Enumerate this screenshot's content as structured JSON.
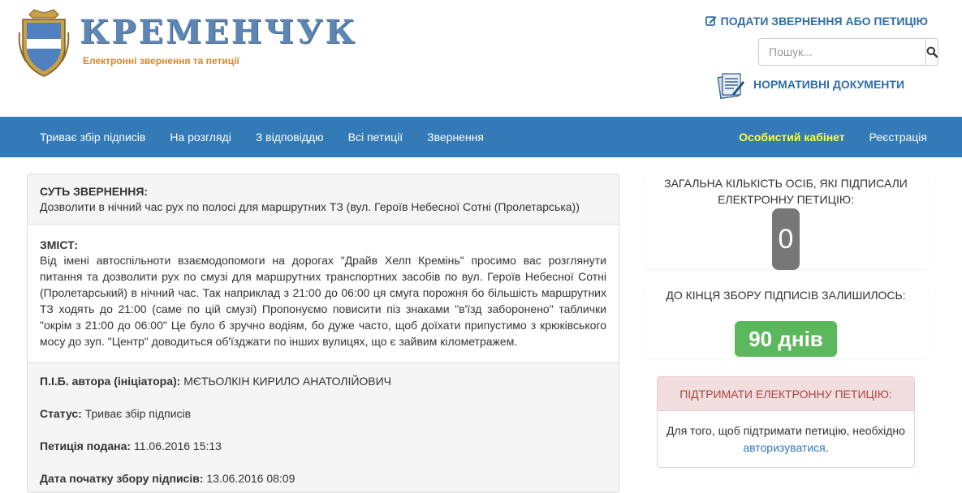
{
  "header": {
    "logo_title": "КРЕМЕНЧУК",
    "logo_subtitle": "Електронні звернення та петиції",
    "submit_link": "ПОДАТИ ЗВЕРНЕННЯ АБО ПЕТИЦІЮ",
    "search_placeholder": "Пошук...",
    "docs_link": "НОРМАТИВНІ ДОКУМЕНТИ"
  },
  "nav": {
    "left": [
      "Триває збір підписів",
      "На розгляді",
      "З відповіддю",
      "Всі петиції",
      "Звернення"
    ],
    "cabinet": "Особистий кабінет",
    "register": "Реєстрація"
  },
  "petition": {
    "essence_label": "СУТЬ ЗВЕРНЕННЯ:",
    "essence_text": "Дозволити в нічний час рух по полосі для маршрутних ТЗ (вул. Героїв Небесної Сотні (Пролетарська))",
    "content_label": "ЗМІСТ:",
    "content_text": "Від імені автоспільноти взаємодопомоги на дорогах \"Драйв Хелп Кремінь\" просимо вас розглянути питання та дозволити рух по смузі для маршрутних транспортних засобів по вул. Героїв Небесної Сотні (Пролетарський) в нічний час. Так наприклад з 21:00 до 06:00 ця смуга порожня бо більшість маршрутних ТЗ ходять до 21:00 (саме по цій смузі) Пропонуємо повисити піз знаками \"в'їзд заборонено\" таблички \"окрім з 21:00 до 06:00\" Це було б зручно водіям, бо дуже часто, щоб доїхати припустимо з крюківського мосу до зуп. \"Центр\" доводиться об'їзджати по інших вулицях, що є зайвим кілометражем.",
    "author_label": "П.І.Б. автора (ініціатора):",
    "author_value": "МЄТЬОЛКІН КИРИЛО АНАТОЛІЙОВИЧ",
    "status_label": "Статус:",
    "status_value": "Триває збір підписів",
    "submitted_label": "Петиція подана:",
    "submitted_value": "11.06.2016 15:13",
    "start_label": "Дата початку збору підписів:",
    "start_value": "13.06.2016 08:09"
  },
  "sidebar": {
    "count_title": "ЗАГАЛЬНА КІЛЬКІСТЬ ОСІБ, ЯКІ ПІДПИСАЛИ ЕЛЕКТРОННУ ПЕТИЦІЮ:",
    "count_value": "0",
    "days_title": "ДО КІНЦЯ ЗБОРУ ПІДПИСІВ ЗАЛИШИЛОСЬ:",
    "days_value": "90 днів",
    "support_title": "ПІДТРИМАТИ ЕЛЕКТРОННУ ПЕТИЦІЮ:",
    "support_text": "Для того, щоб підтримати петицію, необхідно",
    "support_link": "авторизуватися",
    "support_end": "."
  },
  "colors": {
    "navbar": "#337ab7",
    "cabinet": "#ffff33",
    "days_badge": "#5cb85c",
    "count_badge": "#777777",
    "support_head": "#f2dede"
  },
  "icons": [
    "edit-icon",
    "search-icon",
    "documents-icon",
    "city-crest-icon"
  ]
}
